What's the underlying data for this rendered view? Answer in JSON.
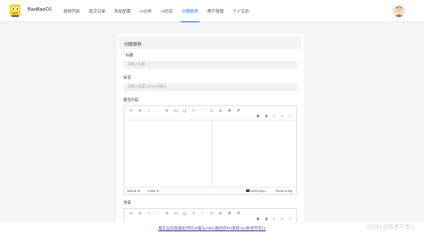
{
  "app": {
    "brand": "BaoBaoOJ"
  },
  "nav": {
    "items": [
      {
        "label": "题目列表"
      },
      {
        "label": "提交记录"
      },
      {
        "label": "系统配置"
      },
      {
        "label": "AI分析"
      },
      {
        "label": "AI问答"
      },
      {
        "label": "创建题目"
      },
      {
        "label": "用户管理"
      },
      {
        "label": "个人信息"
      }
    ],
    "active_index": 5
  },
  "form": {
    "card_title": "创建题目",
    "title_label": "标题",
    "title_placeholder": "请输入标题",
    "tags_label": "标签",
    "tags_placeholder": "请输入标题以Enter键确认",
    "content_label": "题目内容",
    "answer_label": "答案"
  },
  "editor": {
    "toolbar_icons": [
      "H",
      "B",
      "I",
      "“",
      "⊘",
      "</>",
      "{}",
      "≡",
      "⋮",
      "☐",
      "☑",
      "⊞",
      "🗎"
    ],
    "toolbar_right_icons": [
      "▣",
      "◨",
      "▯",
      "▭",
      "⛶"
    ],
    "words_label": "Words:",
    "words_value": "0",
    "lines_label": "Lines:",
    "lines_value": "1",
    "scroll_sync_label": "Scroll sync",
    "scroll_top_label": "Scroll to top"
  },
  "footer": {
    "link_text": "基于自向容器化代码沙箱与AIGC融合的OJ系统 by 肤虎不亮儿"
  },
  "watermark": "CSDN @肤虎不亮儿",
  "colors": {
    "accent": "#1677ff",
    "footer_link": "#5b3fa0"
  }
}
